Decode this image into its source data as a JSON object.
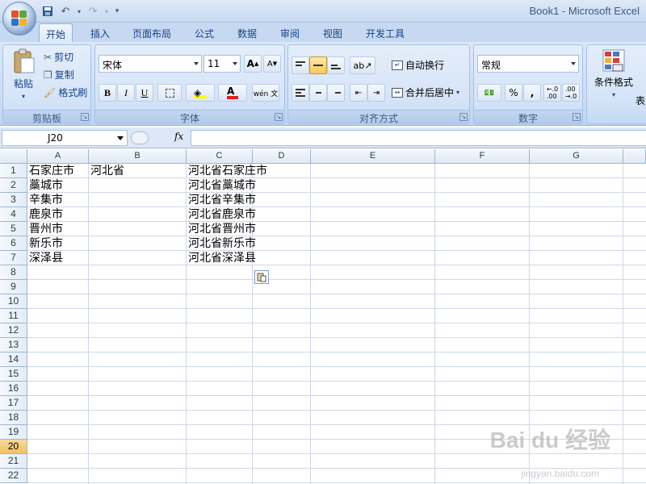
{
  "window": {
    "title": "Book1 - Microsoft Excel"
  },
  "ribbon": {
    "tabs": [
      "开始",
      "插入",
      "页面布局",
      "公式",
      "数据",
      "审阅",
      "视图",
      "开发工具"
    ],
    "active_tab": "开始",
    "clipboard": {
      "paste": "粘贴",
      "cut": "剪切",
      "copy": "复制",
      "format_painter": "格式刷",
      "label": "剪贴板"
    },
    "font": {
      "name": "宋体",
      "size": "11",
      "bold": "B",
      "italic": "I",
      "underline": "U",
      "label": "字体"
    },
    "alignment": {
      "wrap_text": "自动换行",
      "merge_center": "合并后居中",
      "label": "对齐方式"
    },
    "number": {
      "format": "常规",
      "percent": "%",
      "comma": ",",
      "label": "数字"
    },
    "styles": {
      "conditional_format": "条件格式",
      "table_format_partial": "表"
    }
  },
  "formula_bar": {
    "name_box": "J20",
    "fx": "fx",
    "content": ""
  },
  "grid": {
    "columns": [
      "A",
      "B",
      "C",
      "D",
      "E",
      "F",
      "G"
    ],
    "rows": [
      "1",
      "2",
      "3",
      "4",
      "5",
      "6",
      "7",
      "8",
      "9",
      "10",
      "11",
      "12",
      "13",
      "14",
      "15",
      "16",
      "17",
      "18",
      "19",
      "20",
      "21",
      "22"
    ],
    "selected_row": "20",
    "cells": {
      "A1": "石家庄市",
      "B1": "河北省",
      "C1": "河北省石家庄市",
      "A2": "藁城市",
      "C2": "河北省藁城市",
      "A3": "辛集市",
      "C3": "河北省辛集市",
      "A4": "鹿泉市",
      "C4": "河北省鹿泉市",
      "A5": "晋州市",
      "C5": "河北省晋州市",
      "A6": "新乐市",
      "C6": "河北省新乐市",
      "A7": "深泽县",
      "C7": "河北省深泽县"
    }
  },
  "watermark": {
    "main": "Bai du 经验",
    "sub": "jingyan.baidu.com"
  },
  "colors": {
    "ribbon": "#c9dcf3",
    "selected_row": "#f1c15f",
    "gridline": "#d0d7e5"
  }
}
